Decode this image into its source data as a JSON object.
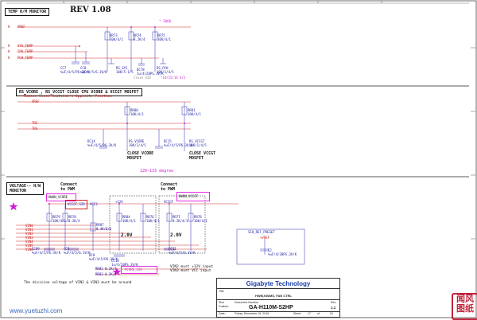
{
  "header": {
    "section_temp": "TEMP H/M MONITOR",
    "rev": "REV 1.08",
    "note_magenta": "* 1修改"
  },
  "temp": {
    "signals": [
      "VREF",
      "SYS_TEMP",
      "CPU_TEMP",
      "PCH_TEMP"
    ],
    "resistors": [
      "RR73\n10K/4/1",
      "RR74\n8.2K/4",
      "RR75\n10K/4/1"
    ],
    "caps": [
      "CC7\n%uF/4/5/P6.3V/K",
      "CC8\n%uF/4/5/6.3V/K",
      "RS_SYS\n10K/5-1/5",
      "DC78\n1u/4/20PS.3V/K",
      "RS_PCH\n10K/1/4/5"
    ],
    "footer": "Close SIO",
    "footer_mag": "*14/15/16 4/2"
  },
  "vcore": {
    "title_line1": "RS_VCORE , RS_VCCGT CLOSE CPU VCORE & VCCGT   MOSFET",
    "title_line2": "Remove Close Heatsink's Opposite Position",
    "inputs": [
      "VREF",
      "TRS",
      "TRS"
    ],
    "resistors": [
      "RR80\n10K/4/1",
      "RR81\n10K/4/1"
    ],
    "parts": [
      "DC14\n%uF/4/5/P6.3V/K",
      "RS_VCORE\n10K/1/4/5",
      "DC15\n%uF/4/5/P6.3V/K",
      "RS_VCCGT\n10K/1/4/5"
    ],
    "close1": "CLOSE VCORE\nMOSFET",
    "close2": "CLOSE VCCGT\nMOSFET",
    "degrees": "126~133 degree"
  },
  "voltage": {
    "section": "VOLTAGE-- H/W\nMONITOR",
    "connect1": "Connect\nto PWM",
    "connect2": "Connect\nto PWM",
    "hw_vcore": "HWON_VCORE",
    "hw_vccgt": "HWON_VCCGT",
    "vccgt_sio": "VCCGT_SIO",
    "vcc3": "VCC3",
    "plus12v": "+12V",
    "vccgt": "VCCGT",
    "readout1": "2.0V",
    "readout2": "2.0V",
    "inputs": [
      "VIN0",
      "VIN1",
      "VIN2",
      "VIN3",
      "VIN4",
      "VIN5",
      "VIN6"
    ],
    "res_row1": [
      "RR79\n10K/4/1",
      "RR78\n8.2K/4",
      "RR87\n8.4K/6/1",
      "RR84\n10K/4/1"
    ],
    "res_row2": [
      "RR76\n10K/4/1",
      "RR77\n8.2K/4/1",
      "RR78\n10K/4/1"
    ],
    "caps": [
      "CC09\n%uF/4/5/P6.3V/K",
      "CC8\n%uF/4/5/6.3V/K",
      "DC8\n%uF/4/5/P6.3V/K",
      "CC10\n1u/4/20PS.3V/K",
      "CC11\n%uF/4/5/6.3V/K"
    ],
    "bottom": [
      "RR82 8.2K/4",
      "RR83 8.2K/4"
    ],
    "note1": "VIN2 must +12V input",
    "note2": "VIN3 must VCC input",
    "division": "The division voltage of VIN2 & VIN3 must be around",
    "vcore_sio": "VCORE_SIO",
    "aux": {
      "label": "SIO_REF_PRESET",
      "net": "+VREF",
      "cap": "C2\n%uF/4/20PS.3V/K"
    }
  },
  "titleblock": {
    "company": "Gigabyte Technology",
    "title_lbl": "Title",
    "title": "HWM,KB/MS, FAN CTRL",
    "size_lbl": "Size",
    "size": "Custom",
    "docnum_lbl": "Document Number",
    "docnum": "GA-H110M-S2HP",
    "rev_lbl": "Rev",
    "rev": "1.1",
    "date_lbl": "Date:",
    "date": "Friday, December 15, 2016",
    "sheet_lbl": "Sheet",
    "sheet": "17",
    "of": "of",
    "total": "51"
  },
  "footer": {
    "watermark": "www.yuetuzhi.com",
    "seal": "闻风\n图纸"
  }
}
